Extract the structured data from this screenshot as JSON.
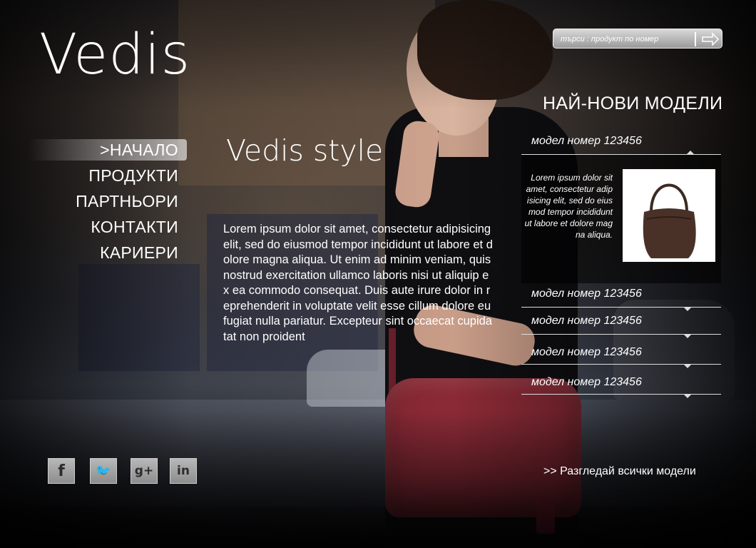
{
  "brand": {
    "logo": "Vedis"
  },
  "nav": {
    "items": [
      {
        "label": ">НАЧАЛО"
      },
      {
        "label": "ПРОДУКТИ"
      },
      {
        "label": "ПАРТНЬОРИ"
      },
      {
        "label": "КОНТАКТИ"
      },
      {
        "label": "КАРИЕРИ"
      }
    ]
  },
  "main": {
    "title": "Vedis style",
    "text": "Lorem ipsum dolor sit amet, consectetur adipisicing elit, sed do eiusmod tempor incididunt ut labore et dolore magna aliqua. Ut enim ad minim veniam, quis nostrud exercitation ullamco laboris nisi ut aliquip ex ea commodo consequat. Duis aute irure dolor in reprehenderit in voluptate velit esse cillum dolore eu fugiat nulla pariatur. Excepteur sint occaecat cupidatat non proident"
  },
  "search": {
    "placeholder": "търси : продукт по номер",
    "icon": "arrow-right-icon"
  },
  "newest": {
    "title": "НАЙ-НОВИ МОДЕЛИ",
    "expanded": {
      "label": "модел номер 123456",
      "description": "Lorem ipsum dolor sit amet, consectetur adipisicing elit, sed do eiusmod tempor incididunt ut labore et dolore magna aliqua."
    },
    "items": [
      {
        "label": "модел номер 123456"
      },
      {
        "label": "модел номер 123456"
      },
      {
        "label": "модел номер 123456"
      },
      {
        "label": "модел номер 123456"
      }
    ],
    "view_all": ">> Разгледай всички модели"
  },
  "social": [
    {
      "icon": "facebook-icon",
      "glyph": "f"
    },
    {
      "icon": "twitter-icon",
      "glyph": "🐦"
    },
    {
      "icon": "google-plus-icon",
      "glyph": "g+"
    },
    {
      "icon": "linkedin-icon",
      "glyph": "in"
    }
  ],
  "colors": {
    "text": "#ffffff",
    "search_bg": "#b0b0b0",
    "line": "#dddddd"
  }
}
